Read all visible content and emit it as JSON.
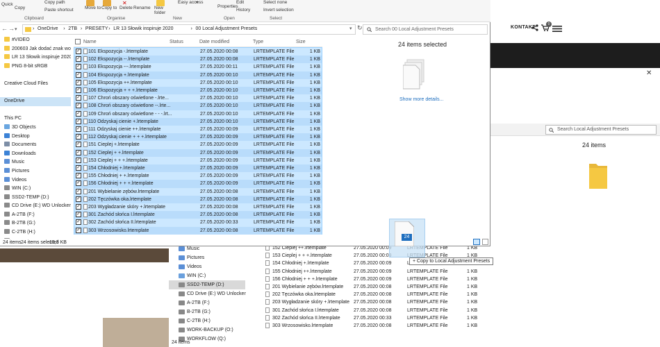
{
  "web": {
    "nav_contact": "KONTAKT",
    "cart_count": "0"
  },
  "ribbon": {
    "quick_label": "Quick",
    "copy_label": "Copy",
    "copy_path": "Copy path",
    "paste_shortcut": "Paste shortcut",
    "move_to": "Move to",
    "copy_to": "Copy to",
    "delete_label": "Delete",
    "rename_label": "Rename",
    "new_folder": "New folder",
    "easy_access": "Easy access",
    "properties": "Properties",
    "edit": "Edit",
    "history": "History",
    "select_none": "Select none",
    "invert_selection": "Invert selection",
    "groups": {
      "clipboard": "Clipboard",
      "organise": "Organise",
      "new": "New",
      "open": "Open",
      "select": "Select"
    }
  },
  "address": {
    "segments": [
      "OneDrive",
      "2TB",
      "PRESETY",
      "LR 13 Słowik inspiruje 2020",
      "00 Local Adjustment Presets"
    ],
    "search_placeholder": "Search 00 Local Adjustment Presets"
  },
  "sidebar": {
    "items": [
      "#VIDEO",
      "200603 Jak dodać znak wodn",
      "LR 13 Słowik inspiruje 2020",
      "PNG 8-bit sRGB",
      "",
      "Creative Cloud Files",
      "",
      "OneDrive",
      "",
      "This PC",
      "3D Objects",
      "Desktop",
      "Documents",
      "Downloads",
      "Music",
      "Pictures",
      "Videos",
      "WIN (C:)",
      "SSD2-TEMP (D:)",
      "CD Drive (E:) WD Unlocker",
      "A-2TB (F:)",
      "B-2TB (G:)",
      "C-2TB (H:)",
      "WORK-BACKUP (O:)",
      "WORKFLOW (Q:)"
    ]
  },
  "columns": {
    "name": "Name",
    "status": "Status",
    "date": "Date modified",
    "type": "Type",
    "size": "Size"
  },
  "files": [
    {
      "name": "101 Ekspozycja -.lrtemplate",
      "date": "27.05.2020 00:08",
      "type": "LRTEMPLATE File",
      "size": "1 KB"
    },
    {
      "name": "102 Ekspozycja --.lrtemplate",
      "date": "27.05.2020 00:08",
      "type": "LRTEMPLATE File",
      "size": "1 KB"
    },
    {
      "name": "103 Ekspozycja ---.lrtemplate",
      "date": "27.05.2020 00:11",
      "type": "LRTEMPLATE File",
      "size": "1 KB"
    },
    {
      "name": "104 Ekspozycja +.lrtemplate",
      "date": "27.05.2020 00:10",
      "type": "LRTEMPLATE File",
      "size": "1 KB"
    },
    {
      "name": "105 Ekspozycja ++.lrtemplate",
      "date": "27.05.2020 00:10",
      "type": "LRTEMPLATE File",
      "size": "1 KB"
    },
    {
      "name": "106 Ekspozycja + + +.lrtemplate",
      "date": "27.05.2020 00:10",
      "type": "LRTEMPLATE File",
      "size": "1 KB"
    },
    {
      "name": "107 Chroń obszary oświetlone -.lrte...",
      "date": "27.05.2020 00:10",
      "type": "LRTEMPLATE File",
      "size": "1 KB"
    },
    {
      "name": "108 Chroń obszary oświetlone --.lrte...",
      "date": "27.05.2020 00:10",
      "type": "LRTEMPLATE File",
      "size": "1 KB"
    },
    {
      "name": "109 Chroń obszary oświetlone - - -.lrt...",
      "date": "27.05.2020 00:10",
      "type": "LRTEMPLATE File",
      "size": "1 KB"
    },
    {
      "name": "110 Odzyskaj cienie +.lrtemplate",
      "date": "27.05.2020 00:10",
      "type": "LRTEMPLATE File",
      "size": "1 KB"
    },
    {
      "name": "111 Odzyskaj cienie ++.lrtemplate",
      "date": "27.05.2020 00:09",
      "type": "LRTEMPLATE File",
      "size": "1 KB"
    },
    {
      "name": "112 Odzyskaj cienie + + +.lrtemplate",
      "date": "27.05.2020 00:09",
      "type": "LRTEMPLATE File",
      "size": "1 KB"
    },
    {
      "name": "151 Cieplej +.lrtemplate",
      "date": "27.05.2020 00:09",
      "type": "LRTEMPLATE File",
      "size": "1 KB"
    },
    {
      "name": "152 Cieplej + +.lrtemplate",
      "date": "27.05.2020 00:09",
      "type": "LRTEMPLATE File",
      "size": "1 KB"
    },
    {
      "name": "153 Cieplej + + +.lrtemplate",
      "date": "27.05.2020 00:09",
      "type": "LRTEMPLATE File",
      "size": "1 KB"
    },
    {
      "name": "154 Chłodniej +.lrtemplate",
      "date": "27.05.2020 00:09",
      "type": "LRTEMPLATE File",
      "size": "1 KB"
    },
    {
      "name": "155 Chłodniej + +.lrtemplate",
      "date": "27.05.2020 00:09",
      "type": "LRTEMPLATE File",
      "size": "1 KB"
    },
    {
      "name": "156 Chłodniej + + +.lrtemplate",
      "date": "27.05.2020 00:09",
      "type": "LRTEMPLATE File",
      "size": "1 KB"
    },
    {
      "name": "201 Wybielanie zębów.lrtemplate",
      "date": "27.05.2020 00:08",
      "type": "LRTEMPLATE File",
      "size": "1 KB"
    },
    {
      "name": "202 Tęczówka oka.lrtemplate",
      "date": "27.05.2020 00:08",
      "type": "LRTEMPLATE File",
      "size": "1 KB"
    },
    {
      "name": "203 Wygładzanie skóry +.lrtemplate",
      "date": "27.05.2020 00:08",
      "type": "LRTEMPLATE File",
      "size": "1 KB"
    },
    {
      "name": "301 Zachód słońca I.lrtemplate",
      "date": "27.05.2020 00:08",
      "type": "LRTEMPLATE File",
      "size": "1 KB"
    },
    {
      "name": "302 Zachód słońca II.lrtemplate",
      "date": "27.05.2020 00:33",
      "type": "LRTEMPLATE File",
      "size": "1 KB"
    },
    {
      "name": "303 Wrzosowisko.lrtemplate",
      "date": "27.05.2020 00:08",
      "type": "LRTEMPLATE File",
      "size": "1 KB"
    }
  ],
  "details": {
    "selected_text": "24 items selected",
    "show_more": "Show more details..."
  },
  "status": {
    "items": "24 items",
    "selected": "24 items selected",
    "size": "13,3 KB"
  },
  "drag": {
    "count": "24",
    "tooltip": "+ Copy to Local Adjustment Presets"
  },
  "back_window": {
    "search_placeholder": "Search Local Adjustment Presets",
    "count": "24 items",
    "status": "24 items",
    "sidebar": [
      "Music",
      "Pictures",
      "Videos",
      "WIN (C:)",
      "SSD2-TEMP (D:)",
      "CD Drive (E:) WD Unlocker",
      "A-2TB (F:)",
      "B-2TB (G:)",
      "C-2TB (H:)",
      "WORK-BACKUP (O:)",
      "WORKFLOW (Q:)"
    ],
    "files": [
      {
        "name": "152 Cieplej ++.lrtemplate",
        "date": "27.05.2020 00:09",
        "type": "LRTEMPLATE File",
        "size": "1 KB"
      },
      {
        "name": "153 Cieplej + + +.lrtemplate",
        "date": "27.05.2020 00:09",
        "type": "LRTEMPLATE File",
        "size": "1 KB"
      },
      {
        "name": "154 Chłodniej +.lrtemplate",
        "date": "27.05.2020 00:09",
        "type": "LRTEMPLATE File",
        "size": "1 KB"
      },
      {
        "name": "155 Chłodniej ++.lrtemplate",
        "date": "27.05.2020 00:09",
        "type": "LRTEMPLATE File",
        "size": "1 KB"
      },
      {
        "name": "156 Chłodniej + + +.lrtemplate",
        "date": "27.05.2020 00:09",
        "type": "LRTEMPLATE File",
        "size": "1 KB"
      },
      {
        "name": "201 Wybielanie zębów.lrtemplate",
        "date": "27.05.2020 00:08",
        "type": "LRTEMPLATE File",
        "size": "1 KB"
      },
      {
        "name": "202 Tęczówka oka.lrtemplate",
        "date": "27.05.2020 00:08",
        "type": "LRTEMPLATE File",
        "size": "1 KB"
      },
      {
        "name": "203 Wygładzanie skóry +.lrtemplate",
        "date": "27.05.2020 00:08",
        "type": "LRTEMPLATE File",
        "size": "1 KB"
      },
      {
        "name": "301 Zachód słońca I.lrtemplate",
        "date": "27.05.2020 00:08",
        "type": "LRTEMPLATE File",
        "size": "1 KB"
      },
      {
        "name": "302 Zachód słońca II.lrtemplate",
        "date": "27.05.2020 00:33",
        "type": "LRTEMPLATE File",
        "size": "1 KB"
      },
      {
        "name": "303 Wrzosowisko.lrtemplate",
        "date": "27.05.2020 00:08",
        "type": "LRTEMPLATE File",
        "size": "1 KB"
      }
    ]
  },
  "colors": {
    "selection": "#cce8ff",
    "selection_alt": "#b9dcfb",
    "link": "#1f6fbf",
    "folder": "#f5c842"
  }
}
